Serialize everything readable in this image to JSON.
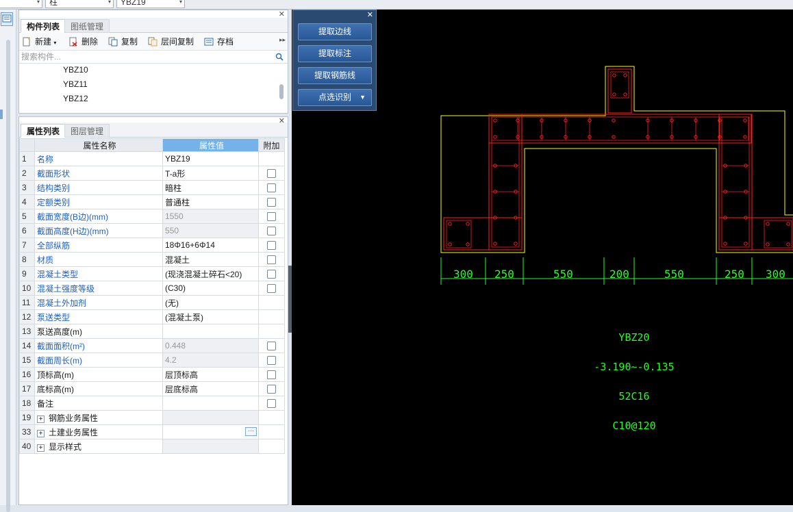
{
  "topbar": {
    "combo1": "",
    "combo2": "柱",
    "combo3": "YBZ19"
  },
  "component_panel": {
    "tabs": [
      "构件列表",
      "图纸管理"
    ],
    "toolbar": {
      "new": "新建",
      "delete": "删除",
      "copy": "复制",
      "floor_copy": "层间复制",
      "save": "存档"
    },
    "search_placeholder": "搜索构件...",
    "items": [
      "YBZ10",
      "YBZ11",
      "YBZ12"
    ]
  },
  "props_panel": {
    "tabs": [
      "属性列表",
      "图层管理"
    ],
    "headers": {
      "name": "属性名称",
      "value": "属性值",
      "extra": "附加"
    },
    "rows": [
      {
        "num": "1",
        "name": "名称",
        "value": "YBZ19"
      },
      {
        "num": "2",
        "name": "截面形状",
        "value": "T-a形"
      },
      {
        "num": "3",
        "name": "结构类别",
        "value": "暗柱"
      },
      {
        "num": "4",
        "name": "定额类别",
        "value": "普通柱"
      },
      {
        "num": "5",
        "name": "截面宽度(B边)(mm)",
        "value": "1550"
      },
      {
        "num": "6",
        "name": "截面高度(H边)(mm)",
        "value": "550"
      },
      {
        "num": "7",
        "name": "全部纵筋",
        "value": "18Φ16+6Φ14"
      },
      {
        "num": "8",
        "name": "材质",
        "value": "混凝土"
      },
      {
        "num": "9",
        "name": "混凝土类型",
        "value": "(现浇混凝土碎石<20)"
      },
      {
        "num": "10",
        "name": "混凝土强度等级",
        "value": "(C30)"
      },
      {
        "num": "11",
        "name": "混凝土外加剂",
        "value": "(无)"
      },
      {
        "num": "12",
        "name": "泵送类型",
        "value": "(混凝土泵)"
      },
      {
        "num": "13",
        "name": "泵送高度(m)",
        "value": ""
      },
      {
        "num": "14",
        "name": "截面面积(m²)",
        "value": "0.448"
      },
      {
        "num": "15",
        "name": "截面周长(m)",
        "value": "4.2"
      },
      {
        "num": "16",
        "name": "顶标高(m)",
        "value": "层顶标高"
      },
      {
        "num": "17",
        "name": "底标高(m)",
        "value": "层底标高"
      },
      {
        "num": "18",
        "name": "备注",
        "value": ""
      },
      {
        "num": "19",
        "name": "钢筋业务属性",
        "value": ""
      },
      {
        "num": "33",
        "name": "土建业务属性",
        "value": ""
      },
      {
        "num": "40",
        "name": "显示样式",
        "value": ""
      }
    ]
  },
  "float_panel": {
    "buttons": [
      "提取边线",
      "提取标注",
      "提取钢筋线",
      "点选识别"
    ]
  },
  "drawing": {
    "dimensions": [
      "300",
      "250",
      "550",
      "200",
      "550",
      "250",
      "300"
    ],
    "labels": [
      "YBZ20",
      "-3.190~-0.135",
      "52C16",
      "C10@120"
    ],
    "colors": {
      "outline": "#ffff00",
      "rebar": "#ff2020",
      "dims": "#22ff22",
      "background": "#000000"
    }
  }
}
